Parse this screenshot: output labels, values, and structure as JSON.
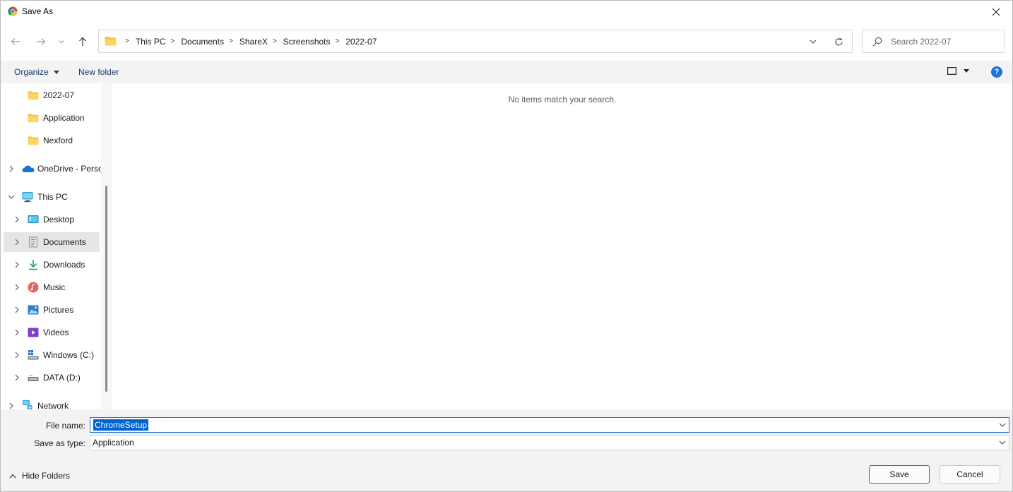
{
  "window": {
    "title": "Save As",
    "close_glyph": "✕"
  },
  "nav": {
    "back_icon": "back-arrow-icon",
    "forward_icon": "forward-arrow-icon",
    "recent_icon": "chevron-down-icon",
    "up_icon": "up-arrow-icon"
  },
  "address": {
    "crumbs": [
      "This PC",
      "Documents",
      "ShareX",
      "Screenshots",
      "2022-07"
    ]
  },
  "search": {
    "placeholder": "Search 2022-07"
  },
  "command_bar": {
    "organize": "Organize",
    "new_folder": "New folder",
    "help": "?"
  },
  "sidebar": {
    "items": [
      {
        "label": "2022-07",
        "icon": "folder-icon"
      },
      {
        "label": "Application",
        "icon": "folder-icon"
      },
      {
        "label": "Nexford",
        "icon": "folder-icon"
      },
      {
        "label": "OneDrive - Perso",
        "icon": "onedrive-icon"
      },
      {
        "label": "This PC",
        "icon": "this-pc-icon"
      },
      {
        "label": "Desktop",
        "icon": "desktop-icon"
      },
      {
        "label": "Documents",
        "icon": "documents-icon"
      },
      {
        "label": "Downloads",
        "icon": "downloads-icon"
      },
      {
        "label": "Music",
        "icon": "music-icon"
      },
      {
        "label": "Pictures",
        "icon": "pictures-icon"
      },
      {
        "label": "Videos",
        "icon": "videos-icon"
      },
      {
        "label": "Windows (C:)",
        "icon": "drive-c-icon"
      },
      {
        "label": "DATA (D:)",
        "icon": "drive-d-icon"
      },
      {
        "label": "Network",
        "icon": "network-icon"
      }
    ],
    "selected": "Documents"
  },
  "main": {
    "empty_message": "No items match your search."
  },
  "form": {
    "file_name_label": "File name:",
    "file_name_value": "ChromeSetup",
    "save_type_label": "Save as type:",
    "save_type_value": "Application",
    "hide_folders": "Hide Folders",
    "save": "Save",
    "cancel": "Cancel"
  },
  "colors": {
    "accent": "#1a73d9",
    "selection": "#0063d2",
    "folder": "#f5c242",
    "command_bar_bg": "#f3f3f3"
  }
}
